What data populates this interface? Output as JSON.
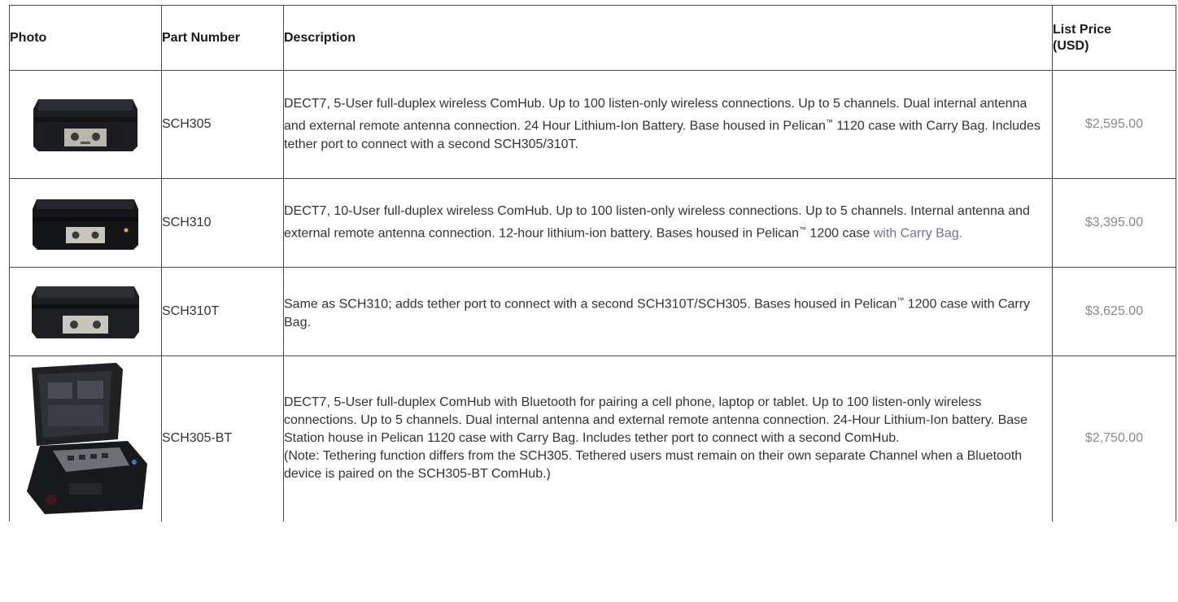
{
  "header": {
    "photo": "Photo",
    "part_number": "Part Number",
    "description": "Description",
    "list_price_line1": "List Price",
    "list_price_line2": "(USD)"
  },
  "rows": [
    {
      "part": "SCH305",
      "desc_a": "DECT7, 5-User full-duplex wireless ComHub. Up to 100 listen-only wireless connections. Up to 5 channels. Dual internal antenna and external remote antenna connection. 24 Hour Lithium-Ion Battery. Base housed in Pelican",
      "tm": "™",
      "desc_b": " 1120 case with Carry Bag. Includes tether port to connect with a second SCH305/310T.",
      "price": "$2,595.00"
    },
    {
      "part": "SCH310",
      "desc_a": "DECT7, 10-User full-duplex wireless ComHub. Up to 100 listen-only wireless connections. Up to 5 channels. Internal antenna and external remote antenna connection. 12-hour lithium-ion battery. Bases housed in Pelican",
      "tm": "™",
      "desc_b": " 1200 case ",
      "desc_c": "with Carry Bag.",
      "price": "$3,395.00"
    },
    {
      "part": "SCH310T",
      "desc_a": "Same as SCH310; adds tether port to connect with a second SCH310T/SCH305. Bases housed in Pelican",
      "tm": "™",
      "desc_b": " 1200 case with Carry Bag.",
      "price": "$3,625.00"
    },
    {
      "part": "SCH305-BT",
      "desc_a": "DECT7, 5-User full-duplex ComHub with Bluetooth for pairing a cell phone, laptop or tablet.  Up to 100 listen-only wireless connections. Up to 5 channels. Dual internal antenna and external remote antenna connection. 24-Hour Lithium-Ion battery. Base Station house in Pelican 1120 case with Carry Bag.  Includes tether port to connect with a second ComHub.",
      "desc_note": "(Note: Tethering function differs from the SCH305. Tethered users must remain on their own separate Channel when a Bluetooth device is paired on the SCH305-BT ComHub.)",
      "price": "$2,750.00"
    }
  ]
}
